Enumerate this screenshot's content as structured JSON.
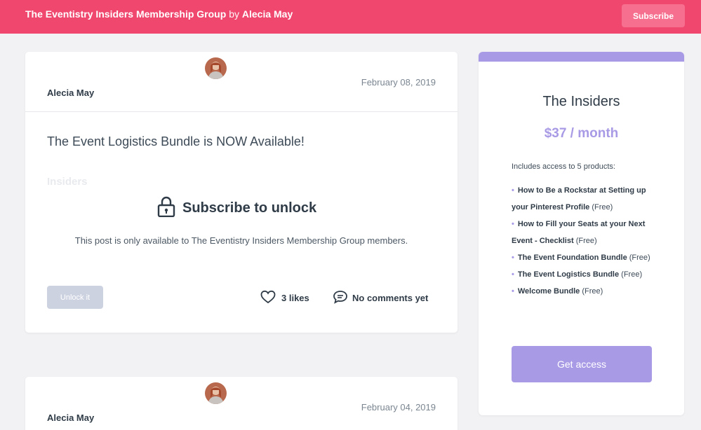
{
  "header": {
    "group_name": "The Eventistry Insiders Membership Group",
    "by_label": "by",
    "owner_name": "Alecia May",
    "subscribe_label": "Subscribe"
  },
  "posts": [
    {
      "author": "Alecia May",
      "date": "February 08, 2019",
      "title": "The Event Logistics Bundle is NOW Available!",
      "tag": "Insiders",
      "lock_title": "Subscribe to unlock",
      "lock_description": "This post is only available to The Eventistry Insiders Membership Group members.",
      "unlock_label": "Unlock it",
      "likes_label": "3 likes",
      "comments_label": "No comments yet"
    },
    {
      "author": "Alecia May",
      "date": "February 04, 2019"
    }
  ],
  "plan": {
    "name": "The Insiders",
    "price": "$37 / month",
    "includes_label": "Includes access to 5 products:",
    "products": [
      {
        "name": "How to Be a Rockstar at Setting up your Pinterest Profile",
        "price": "(Free)"
      },
      {
        "name": "How to Fill your Seats at your Next Event - Checklist",
        "price": "(Free)"
      },
      {
        "name": "The Event Foundation Bundle",
        "price": "(Free)"
      },
      {
        "name": "The Event Logistics Bundle",
        "price": "(Free)"
      },
      {
        "name": "Welcome Bundle",
        "price": "(Free)"
      }
    ],
    "cta_label": "Get access"
  },
  "colors": {
    "brand": "#f0476f",
    "accent": "#a99ae6"
  }
}
